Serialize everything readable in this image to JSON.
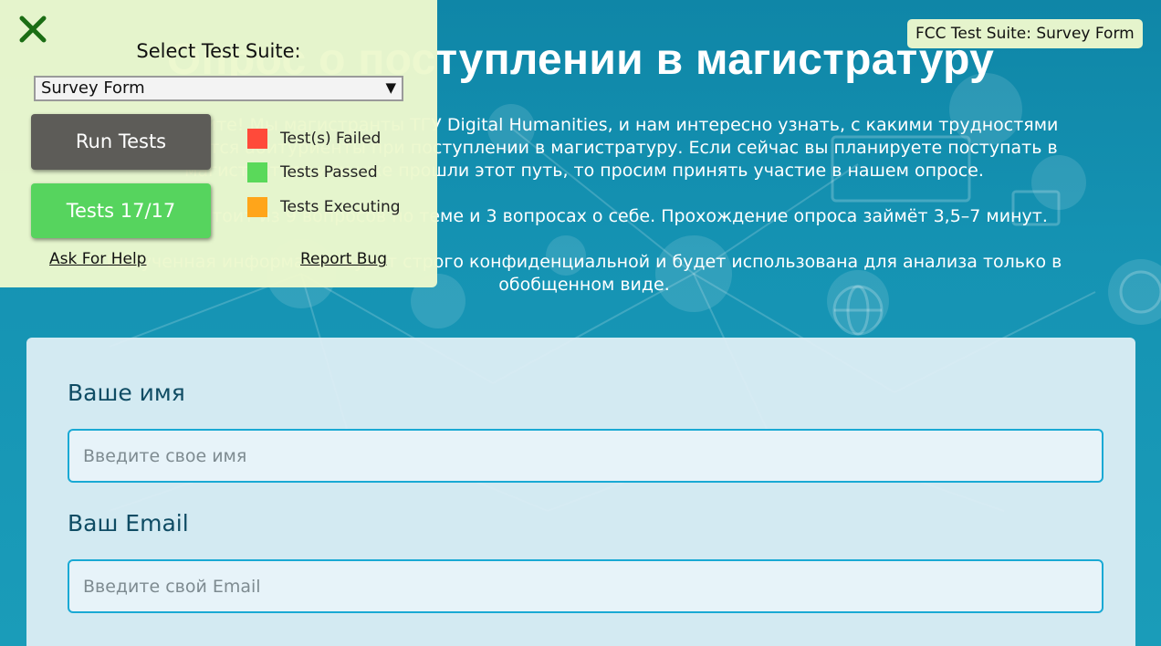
{
  "page": {
    "title": "Опрос о поступлении в магистратуру",
    "description": [
      "Здравствуйте! Мы магистранты ТГУ Digital Humanities, и нам интересно узнать, с какими трудностями сталкиваются абитуриенты при поступлении в магистратуру. Если сейчас вы планируете поступать в магистратуру или уже прошли этот путь, то просим принять участие в нашем опросе.",
      "Опрос состоит из 9 вопросов по теме и 3 вопросах о себе. Прохождение опроса займёт 3,5–7 минут.",
      "Полученная информация будет строго конфиденциальной и будет использована для анализа только в обобщенном виде."
    ]
  },
  "form": {
    "name_label": "Ваше имя",
    "name_placeholder": "Введите свое имя",
    "name_value": "",
    "email_label": "Ваш Email",
    "email_placeholder": "Введите свой Email",
    "email_value": ""
  },
  "fcc": {
    "close_icon": "close-x-icon",
    "select_label": "Select Test Suite:",
    "selected_suite": "Survey Form",
    "run_button": "Run Tests",
    "tests_button": "Tests 17/17",
    "legend": [
      {
        "label": "Test(s) Failed",
        "color": "#ff4a3a"
      },
      {
        "label": "Tests Passed",
        "color": "#5ad95a"
      },
      {
        "label": "Tests Executing",
        "color": "#ffa51a"
      }
    ],
    "help_link": "Ask For Help",
    "bug_link": "Report Bug",
    "badge": "FCC Test Suite: Survey Form"
  },
  "colors": {
    "page_background": "#1289a9",
    "close_icon": "#1b6d14",
    "run_button": "#5d5c58",
    "tests_button": "#56d45e",
    "input_border": "#19a9d4",
    "label_text": "#0f4c64"
  }
}
